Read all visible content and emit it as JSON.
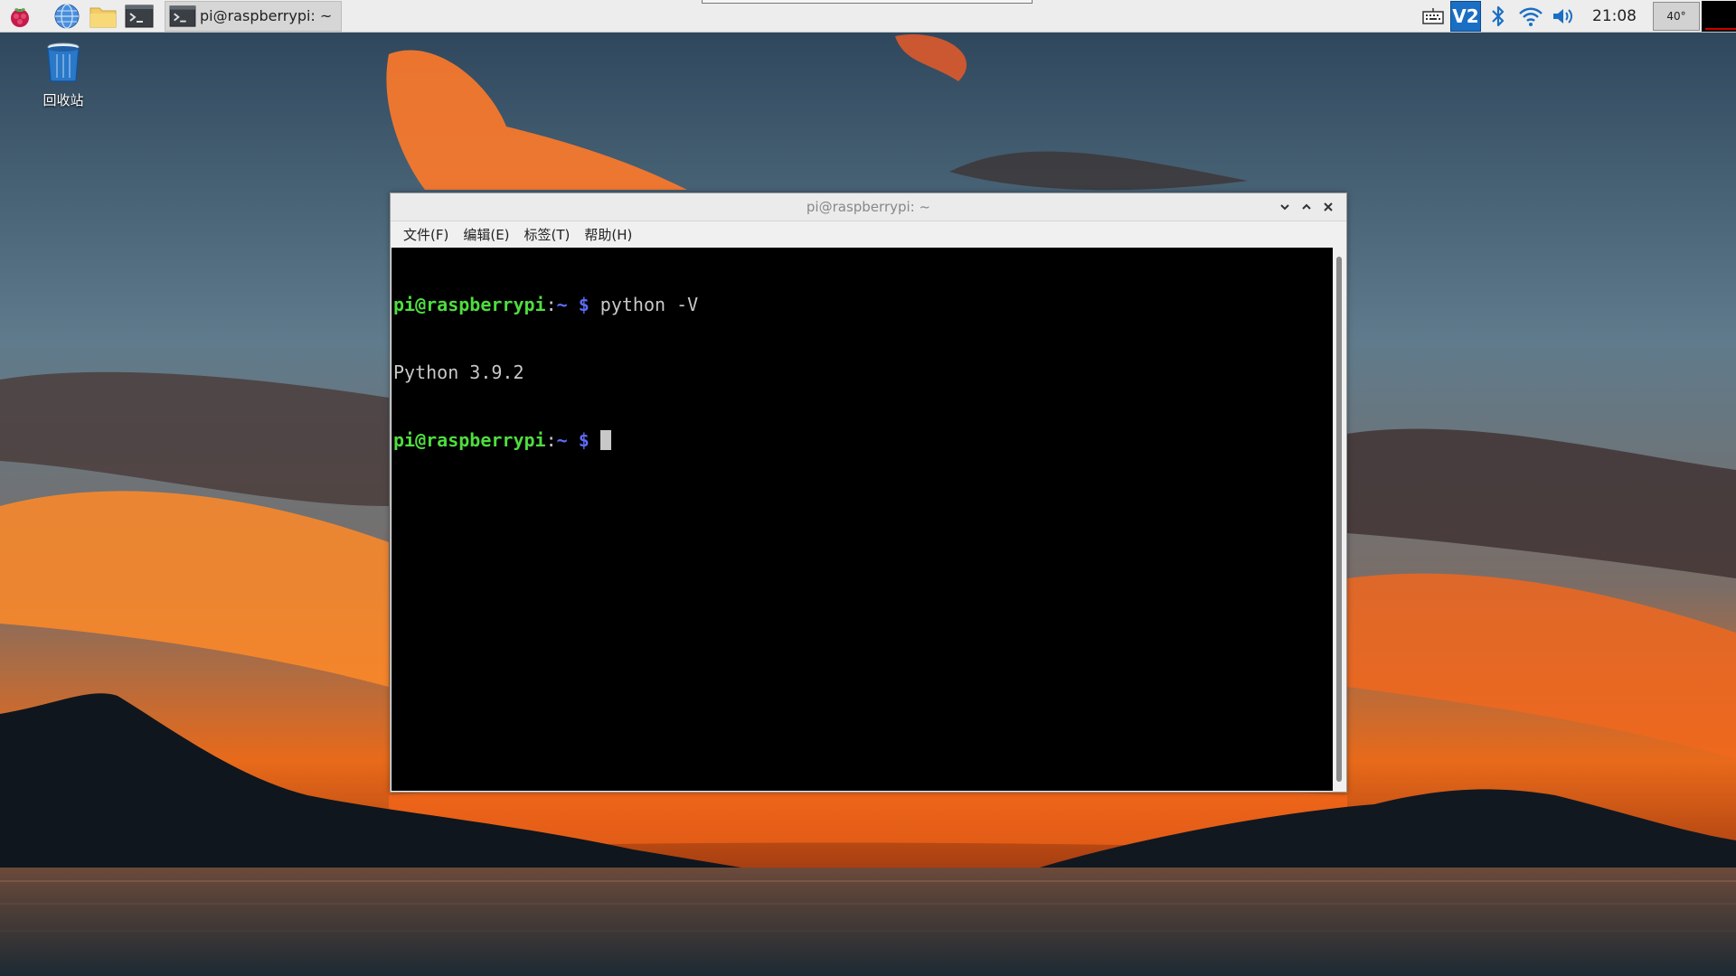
{
  "taskbar": {
    "active_task_label": "pi@raspberrypi: ~"
  },
  "tray": {
    "vnc_text": "V2",
    "clock": "21:08",
    "cpu_temp": "40°"
  },
  "desktop": {
    "trash_label": "回收站"
  },
  "window": {
    "title": "pi@raspberrypi: ~",
    "menus": [
      "文件(F)",
      "编辑(E)",
      "标签(T)",
      "帮助(H)"
    ]
  },
  "terminal": {
    "prompt_user": "pi@raspberrypi",
    "prompt_colon": ":",
    "prompt_path": "~ $",
    "command": " python -V",
    "output": "Python 3.9.2"
  },
  "colors": {
    "prompt_user": "#4fdc3f",
    "prompt_path": "#5c6cf7",
    "terminal_bg": "#000000",
    "panel_bg": "#ededed",
    "vnc_blue": "#1a6fc4"
  }
}
